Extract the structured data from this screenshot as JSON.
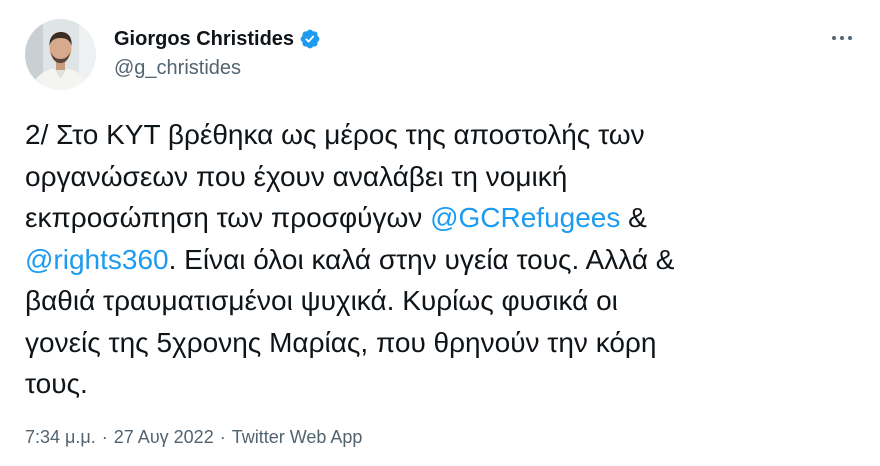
{
  "author": {
    "display_name": "Giorgos Christides",
    "handle": "@g_christides",
    "verified": true
  },
  "tweet": {
    "lines": [
      [
        {
          "text": "2/ Στο ΚΥΤ βρέθηκα ως μέρος της αποστολής των"
        }
      ],
      [
        {
          "text": "οργανώσεων που έχουν αναλάβει τη νομική"
        }
      ],
      [
        {
          "text": "εκπροσώπηση των προσφύγων "
        },
        {
          "mention": "@GCRefugees"
        },
        {
          "text": " &"
        }
      ],
      [
        {
          "mention": "@rights360"
        },
        {
          "text": ". Είναι όλοι καλά στην υγεία τους. Αλλά &"
        }
      ],
      [
        {
          "text": "βαθιά τραυματισμένοι ψυχικά. Κυρίως φυσικά οι"
        }
      ],
      [
        {
          "text": "γονείς της 5χρονης Μαρίας, που θρηνούν την κόρη"
        }
      ],
      [
        {
          "text": "τους."
        }
      ]
    ]
  },
  "meta": {
    "time": "7:34 μ.μ.",
    "separator": "·",
    "date": "27 Αυγ 2022",
    "source": "Twitter Web App"
  },
  "icons": {
    "verified": "verified-badge-icon",
    "more": "more-options-icon"
  },
  "colors": {
    "mention": "#1d9bf0",
    "verified_badge": "#1d9bf0",
    "secondary_text": "#536471",
    "primary_text": "#0f1419"
  }
}
